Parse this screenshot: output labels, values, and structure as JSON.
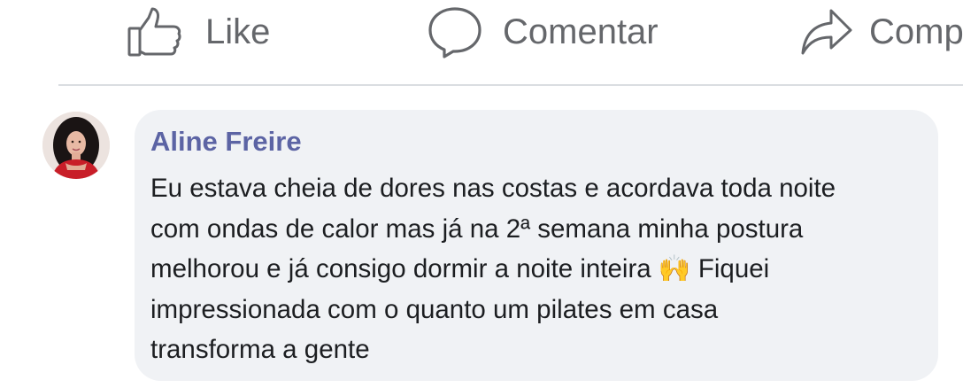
{
  "actions": {
    "like": {
      "label": "Like",
      "icon": "thumbs-up-icon"
    },
    "comment": {
      "label": "Comentar",
      "icon": "speech-bubble-icon"
    },
    "share": {
      "label": "Comp",
      "icon": "share-arrow-icon"
    }
  },
  "comment": {
    "author": "Aline Freire",
    "avatar_icon": "user-avatar",
    "text": "Eu estava cheia de dores nas costas e acordava toda noite\ncom ondas de calor mas já na 2ª semana minha postura\nmelhorou e já consigo dormir a noite inteira 🙌 Fiquei\nimpressionada com o quanto um pilates em casa\ntransforma a gente"
  },
  "colors": {
    "action_gray": "#65676b",
    "author_blue": "#5c64a4",
    "bubble_bg": "#f0f2f5",
    "text": "#1c1e21"
  }
}
